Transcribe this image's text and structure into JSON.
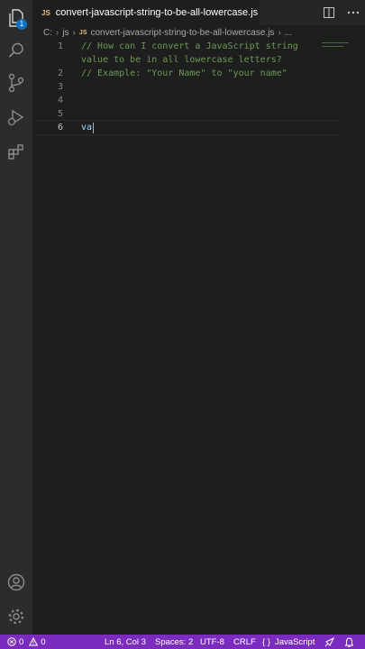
{
  "activity_bar": {
    "explorer_badge": "1"
  },
  "tab": {
    "file_icon": "JS",
    "label": "convert-javascript-string-to-be-all-lowercase.js"
  },
  "breadcrumb": {
    "drive": "C:",
    "folder": "js",
    "file_icon": "JS",
    "file": "convert-javascript-string-to-be-all-lowercase.js",
    "more": "..."
  },
  "editor": {
    "lines": [
      {
        "number": "1",
        "text": "// How can I convert a JavaScript string"
      },
      {
        "number": "",
        "text": "value to be in all lowercase letters?"
      },
      {
        "number": "2",
        "text": "// Example: \"Your Name\" to \"your name\""
      },
      {
        "number": "3",
        "text": ""
      },
      {
        "number": "4",
        "text": ""
      },
      {
        "number": "5",
        "text": ""
      },
      {
        "number": "6",
        "text": "va"
      }
    ]
  },
  "status_bar": {
    "errors": "0",
    "warnings": "0",
    "cursor_position": "Ln 6, Col 3",
    "indentation": "Spaces: 2",
    "encoding": "UTF-8",
    "line_ending": "CRLF",
    "language_braces": "{ }",
    "language": "JavaScript"
  },
  "colors": {
    "status_bar": "#7b2cbf",
    "comment": "#6a9955",
    "badge": "#0e70c0"
  }
}
